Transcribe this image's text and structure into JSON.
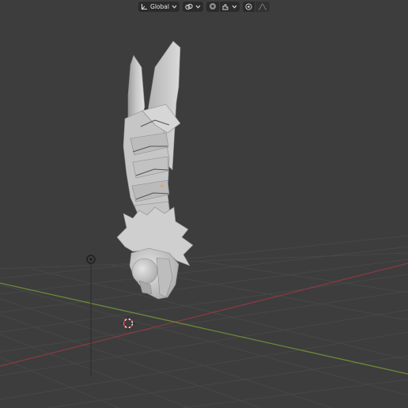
{
  "header": {
    "transform_orientation": "Global",
    "transform_icon": "orientation-axes-icon",
    "pivot_icon": "pivot-link-icon",
    "snap_icon": "snap-magnet-icon",
    "proportional_icon": "proportional-editing-icon",
    "falloff_icon": "falloff-curve-icon"
  },
  "scene": {
    "object": "sculpted-gauntlet-mesh",
    "colors": {
      "background": "#3d3d3d",
      "grid": "#4a4a4a",
      "x_axis": "#8a3a44",
      "y_axis": "#6a8a3a",
      "mesh": "#c8c8c8"
    }
  }
}
